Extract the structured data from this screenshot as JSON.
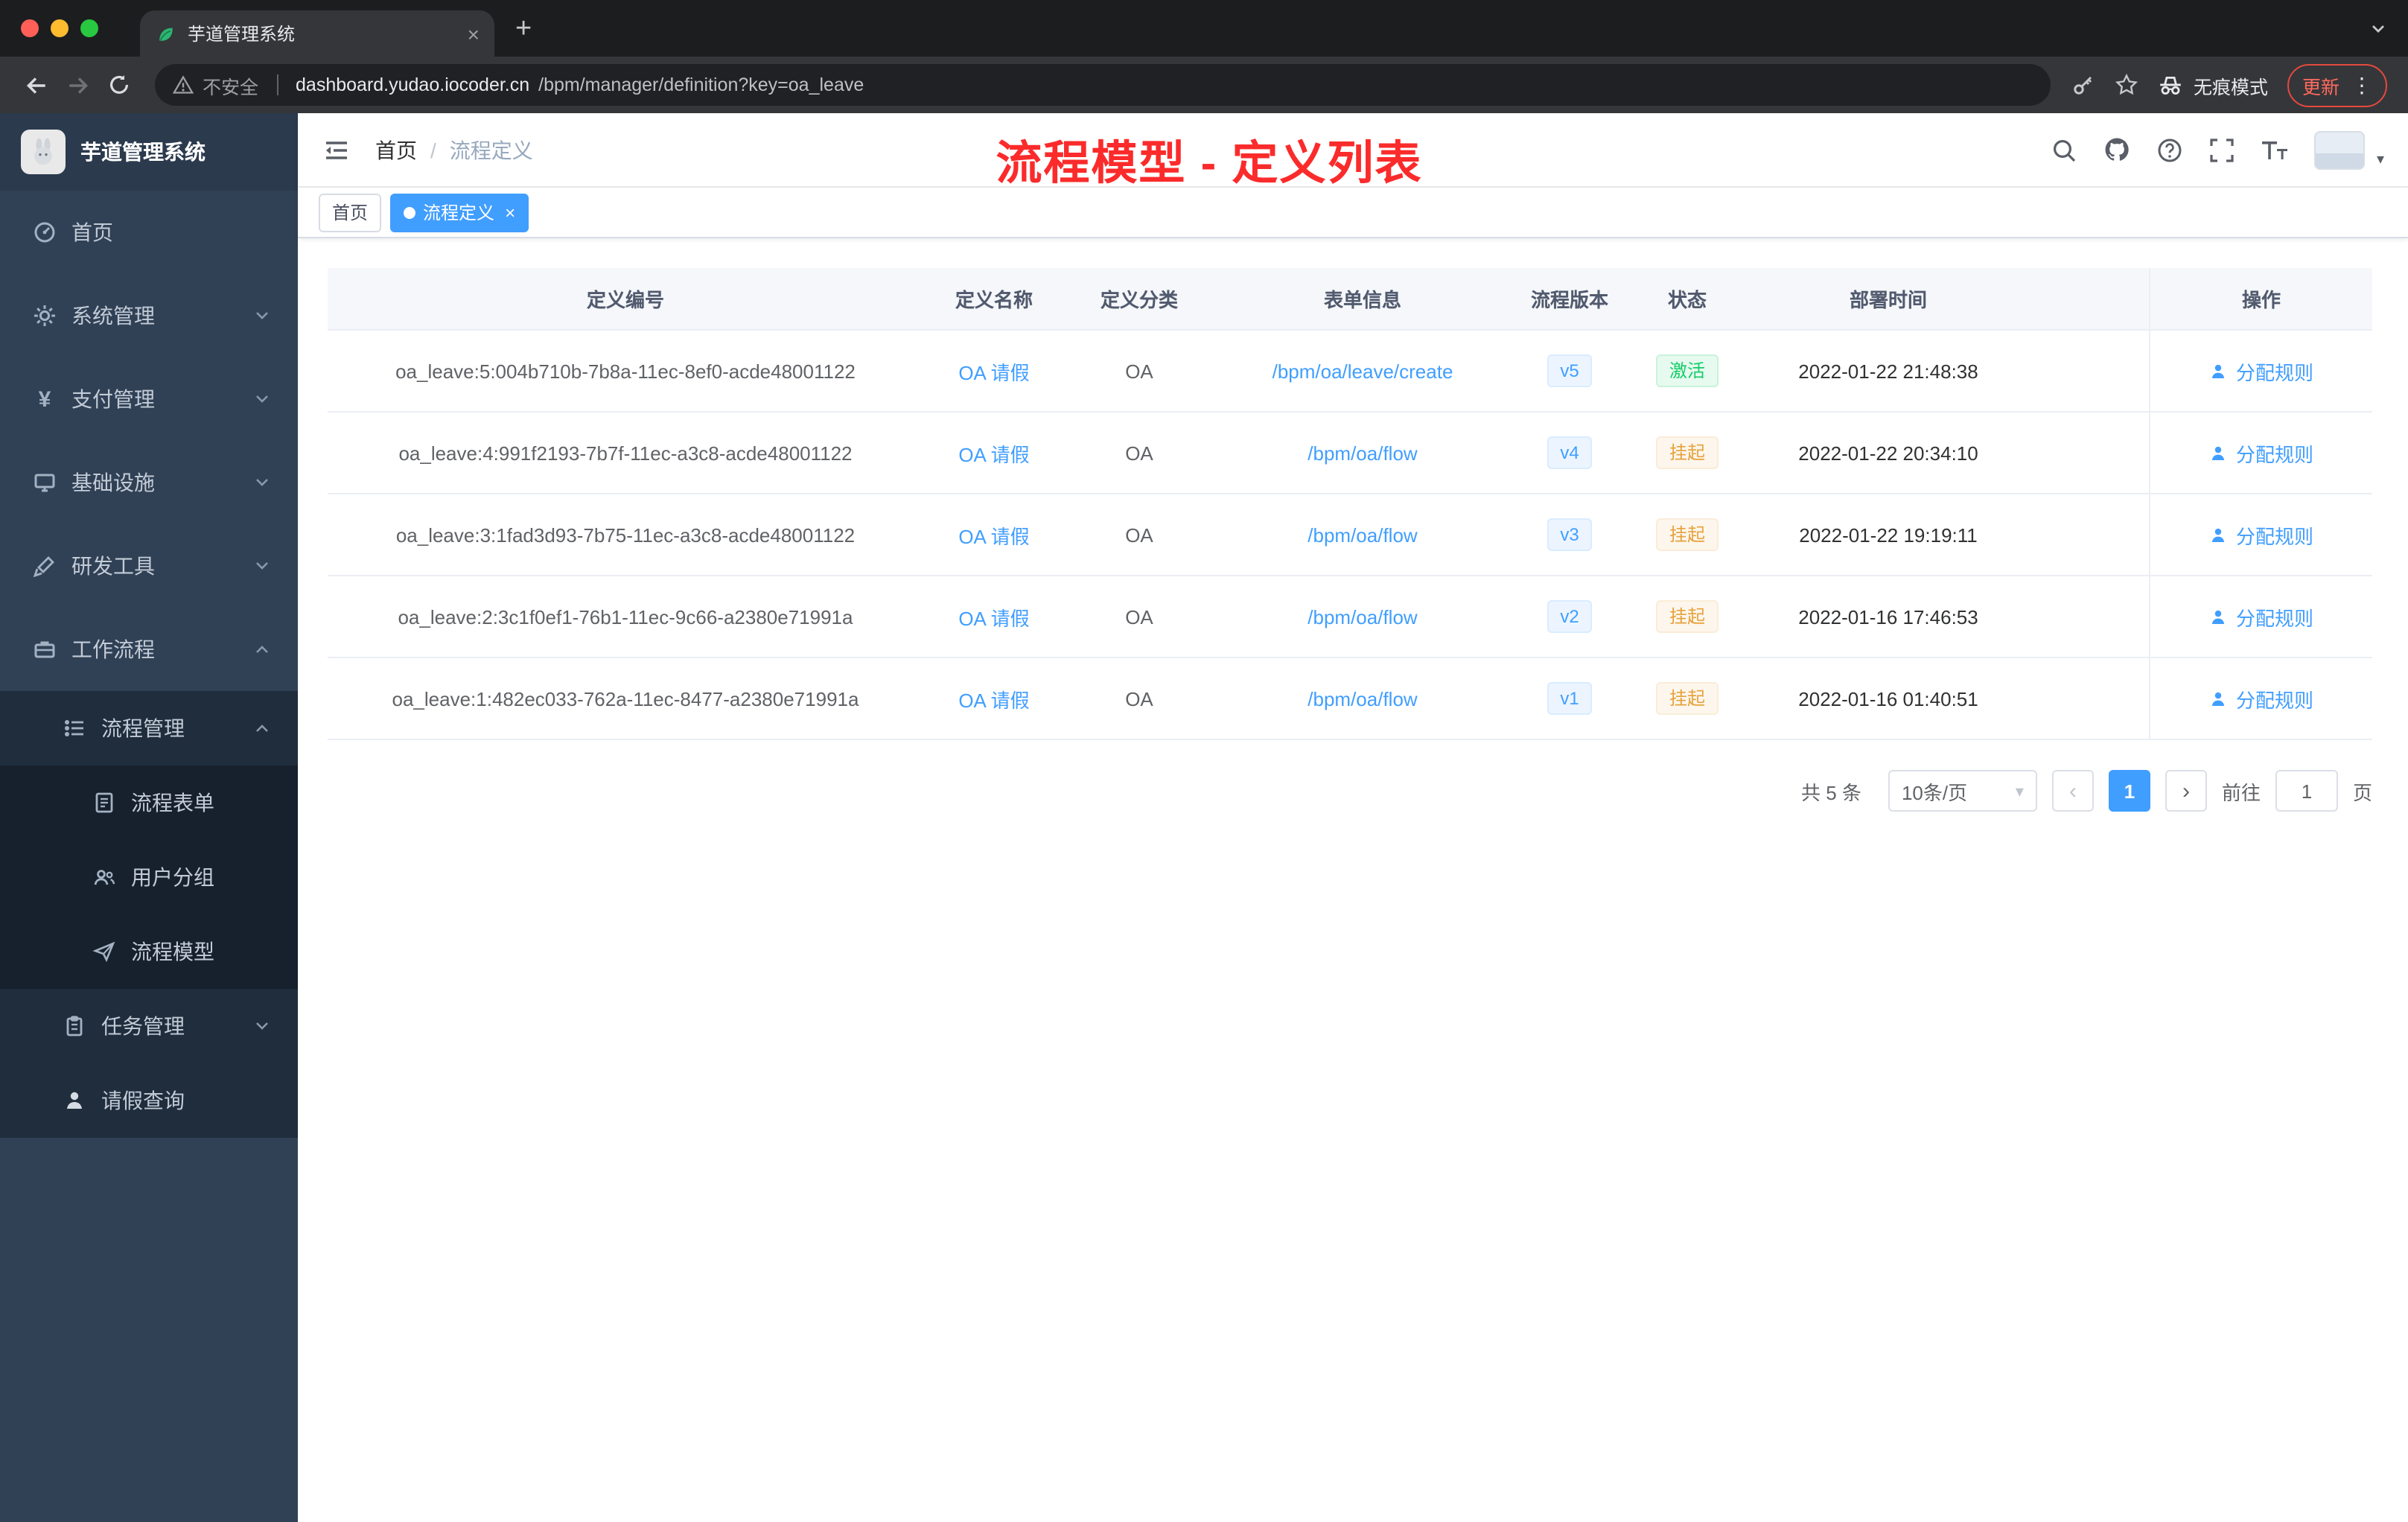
{
  "browser": {
    "tab_title": "芋道管理系统",
    "security_label": "不安全",
    "url_domain": "dashboard.yudao.iocoder.cn",
    "url_path": "/bpm/manager/definition?key=oa_leave",
    "incognito_label": "无痕模式",
    "update_label": "更新"
  },
  "sidebar": {
    "logo_title": "芋道管理系统",
    "items": [
      {
        "label": "首页"
      },
      {
        "label": "系统管理"
      },
      {
        "label": "支付管理"
      },
      {
        "label": "基础设施"
      },
      {
        "label": "研发工具"
      },
      {
        "label": "工作流程"
      },
      {
        "label": "流程管理"
      },
      {
        "label": "流程表单"
      },
      {
        "label": "用户分组"
      },
      {
        "label": "流程模型"
      },
      {
        "label": "任务管理"
      },
      {
        "label": "请假查询"
      }
    ]
  },
  "header": {
    "breadcrumb_home": "首页",
    "breadcrumb_separator": "/",
    "breadcrumb_current": "流程定义",
    "annotation": "流程模型 - 定义列表"
  },
  "tags": [
    {
      "label": "首页"
    },
    {
      "label": "流程定义"
    }
  ],
  "table": {
    "columns": [
      "定义编号",
      "定义名称",
      "定义分类",
      "表单信息",
      "流程版本",
      "状态",
      "部署时间",
      "操作"
    ],
    "rows": [
      {
        "id": "oa_leave:5:004b710b-7b8a-11ec-8ef0-acde48001122",
        "name": "OA 请假",
        "category": "OA",
        "form": "/bpm/oa/leave/create",
        "version": "v5",
        "status": "激活",
        "time": "2022-01-22 21:48:38",
        "action": "分配规则"
      },
      {
        "id": "oa_leave:4:991f2193-7b7f-11ec-a3c8-acde48001122",
        "name": "OA 请假",
        "category": "OA",
        "form": "/bpm/oa/flow",
        "version": "v4",
        "status": "挂起",
        "time": "2022-01-22 20:34:10",
        "action": "分配规则"
      },
      {
        "id": "oa_leave:3:1fad3d93-7b75-11ec-a3c8-acde48001122",
        "name": "OA 请假",
        "category": "OA",
        "form": "/bpm/oa/flow",
        "version": "v3",
        "status": "挂起",
        "time": "2022-01-22 19:19:11",
        "action": "分配规则"
      },
      {
        "id": "oa_leave:2:3c1f0ef1-76b1-11ec-9c66-a2380e71991a",
        "name": "OA 请假",
        "category": "OA",
        "form": "/bpm/oa/flow",
        "version": "v2",
        "status": "挂起",
        "time": "2022-01-16 17:46:53",
        "action": "分配规则"
      },
      {
        "id": "oa_leave:1:482ec033-762a-11ec-8477-a2380e71991a",
        "name": "OA 请假",
        "category": "OA",
        "form": "/bpm/oa/flow",
        "version": "v1",
        "status": "挂起",
        "time": "2022-01-16 01:40:51",
        "action": "分配规则"
      }
    ]
  },
  "pagination": {
    "total_label": "共 5 条",
    "page_size_label": "10条/页",
    "current_page": "1",
    "goto_label": "前往",
    "goto_value": "1",
    "page_unit": "页"
  },
  "colors": {
    "accent_blue": "#409eff",
    "status_active_green": "#13ce66",
    "status_suspend_orange": "#e6a23c",
    "annotation_red": "#fb2b2b",
    "sidebar_bg": "#304156"
  }
}
